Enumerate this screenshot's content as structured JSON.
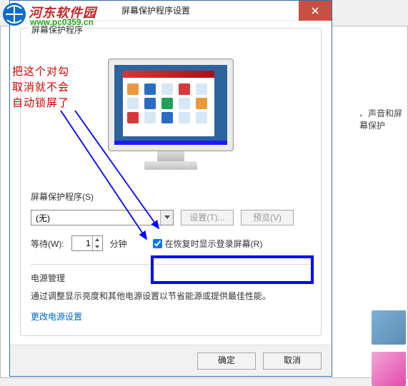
{
  "logo": {
    "text": "河东软件园",
    "url": "www.pc0359.cn"
  },
  "bg_text": "、声音和屏幕保护",
  "dialog": {
    "title": "屏幕保护程序设置",
    "close_icon": "×",
    "groupbox": {
      "legend": "屏幕保护程序",
      "screensaver_label": "屏幕保护程序(S)",
      "select_value": "(无)",
      "settings_btn": "设置(T)...",
      "preview_btn": "预览(V)",
      "wait_label": "等待(W):",
      "wait_value": "1",
      "wait_unit": "分钟",
      "resume_checkbox_label": "在恢复时显示登录屏幕(R)",
      "resume_checked": true,
      "power_heading": "电源管理",
      "power_desc": "通过调整显示亮度和其他电源设置以节省能源或提供最佳性能。",
      "power_link": "更改电源设置"
    },
    "footer": {
      "ok": "确定",
      "cancel": "取消"
    }
  },
  "annotation": [
    "把这个对勾",
    "取消就不会",
    "自动锁屏了"
  ]
}
